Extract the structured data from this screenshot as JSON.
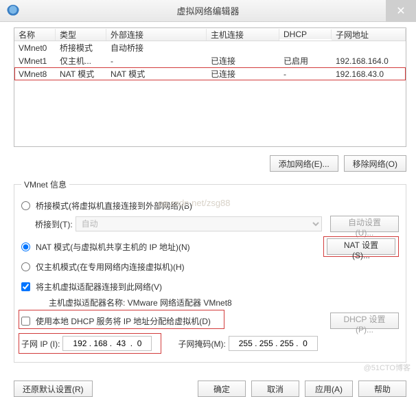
{
  "title": "虚拟网络编辑器",
  "close_glyph": "✕",
  "columns": {
    "name": "名称",
    "type": "类型",
    "ext": "外部连接",
    "host": "主机连接",
    "dhcp": "DHCP",
    "subnet": "子网地址"
  },
  "rows": [
    {
      "name": "VMnet0",
      "type": "桥接模式",
      "ext": "自动桥接",
      "host": "",
      "dhcp": "",
      "subnet": ""
    },
    {
      "name": "VMnet1",
      "type": "仅主机...",
      "ext": "-",
      "host": "已连接",
      "dhcp": "已启用",
      "subnet": "192.168.164.0"
    },
    {
      "name": "VMnet8",
      "type": "NAT 模式",
      "ext": "NAT 模式",
      "host": "已连接",
      "dhcp": "-",
      "subnet": "192.168.43.0"
    }
  ],
  "buttons": {
    "add": "添加网络(E)...",
    "remove": "移除网络(O)"
  },
  "fieldset_legend": "VMnet 信息",
  "radios": {
    "bridge": "桥接模式(将虚拟机直接连接到外部网络)(B)",
    "nat": "NAT 模式(与虚拟机共享主机的 IP 地址)(N)",
    "host": "仅主机模式(在专用网络内连接虚拟机)(H)"
  },
  "bridge_to_label": "桥接到(T):",
  "bridge_to_value": "自动",
  "auto_btn": "自动设置(U)...",
  "nat_btn": "NAT 设置(S)...",
  "chk_hostadapter": "将主机虚拟适配器连接到此网络(V)",
  "adapter_line": "主机虚拟适配器名称: VMware 网络适配器 VMnet8",
  "chk_dhcp": "使用本地 DHCP 服务将 IP 地址分配给虚拟机(D)",
  "dhcp_btn": "DHCP 设置(P)...",
  "subnet_ip_label": "子网 IP (I):",
  "subnet_ip_value": "192 . 168 .  43  .  0",
  "subnet_mask_label": "子网掩码(M):",
  "subnet_mask_value": "255 . 255 . 255 .  0",
  "footer": {
    "restore": "还原默认设置(R)",
    "ok": "确定",
    "cancel": "取消",
    "apply": "应用(A)",
    "help": "帮助"
  },
  "watermark": "og.csdn.net/zsg88",
  "corner": "@51CTO博客"
}
